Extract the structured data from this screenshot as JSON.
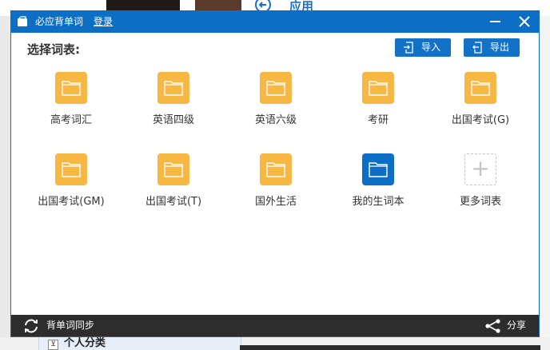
{
  "background": {
    "app_title": "应用",
    "tree_toggle": "⊻",
    "tree_label": "个人分类"
  },
  "dialog": {
    "title": "必应背单词",
    "login": "登录"
  },
  "section_title": "选择词表:",
  "toolbar": {
    "import_label": "导入",
    "export_label": "导出"
  },
  "wordlists": [
    {
      "label": "高考词汇"
    },
    {
      "label": "英语四级"
    },
    {
      "label": "英语六级"
    },
    {
      "label": "考研"
    },
    {
      "label": "出国考试(G)"
    },
    {
      "label": "出国考试(GM)"
    },
    {
      "label": "出国考试(T)"
    },
    {
      "label": "国外生活"
    },
    {
      "label": "我的生词本"
    },
    {
      "label": "更多词表"
    }
  ],
  "footer": {
    "sync_label": "背单词同步",
    "share_label": "分享"
  },
  "colors": {
    "accent": "#0c6fc5",
    "folder": "#f6b843",
    "folder_selected": "#0c6fc5",
    "footer": "#2d2d2d"
  },
  "icons": {
    "folder": "folder-icon",
    "add": "plus-icon",
    "sync": "sync-icon",
    "share": "share-icon",
    "import": "import-icon",
    "export": "export-icon",
    "close": "close-icon",
    "minimize": "minimize-icon"
  }
}
